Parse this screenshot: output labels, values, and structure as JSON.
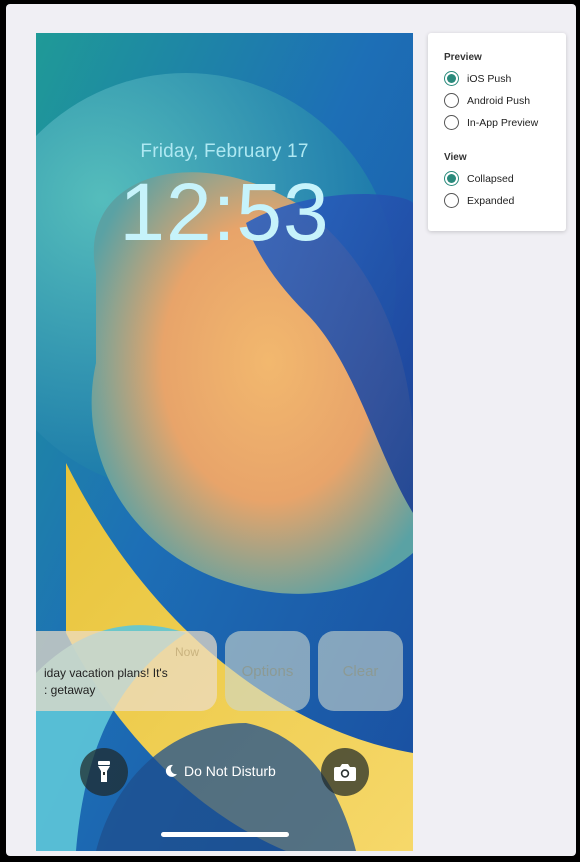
{
  "lockscreen": {
    "date": "Friday, February 17",
    "time": "12:53",
    "notification": {
      "time": "Now",
      "body": "iday vacation plans! It's\n: getaway"
    },
    "options_label": "Options",
    "clear_label": "Clear",
    "dnd_label": "Do Not Disturb",
    "flashlight_icon": "flashlight-icon",
    "camera_icon": "camera-icon",
    "moon_icon": "moon-icon"
  },
  "panel": {
    "preview_title": "Preview",
    "preview_options": [
      {
        "label": "iOS Push",
        "selected": true
      },
      {
        "label": "Android Push",
        "selected": false
      },
      {
        "label": "In-App Preview",
        "selected": false
      }
    ],
    "view_title": "View",
    "view_options": [
      {
        "label": "Collapsed",
        "selected": true
      },
      {
        "label": "Expanded",
        "selected": false
      }
    ],
    "accent_color": "#2a8a7c"
  }
}
